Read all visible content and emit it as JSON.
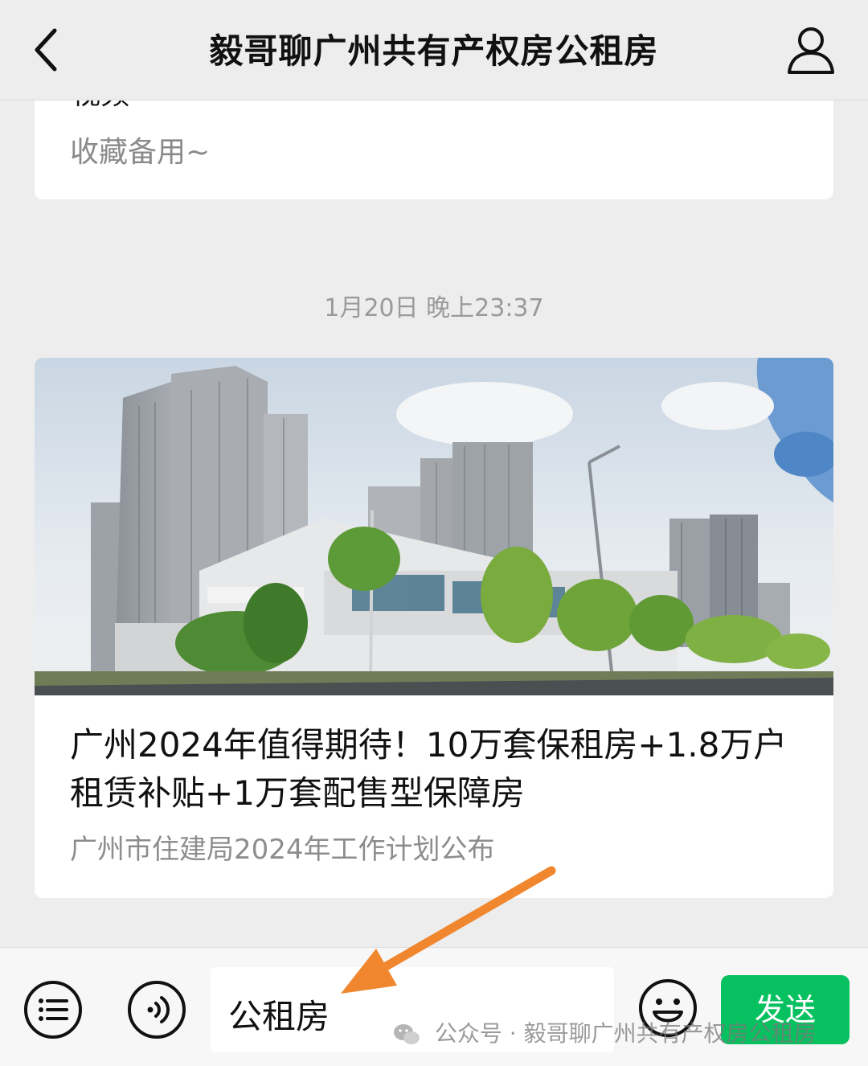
{
  "nav": {
    "title": "毅哥聊广州共有产权房公租房",
    "back_icon": "chevron-left-icon",
    "profile_icon": "person-icon"
  },
  "previous_card": {
    "partial_title": "视频",
    "description": "收藏备用~"
  },
  "timestamp": "1月20日 晚上23:37",
  "article": {
    "title": "广州2024年值得期待！10万套保租房+1.8万户租赁补贴+1万套配售型保障房",
    "subtitle": "广州市住建局2024年工作计划公布",
    "cover_alt": "high-rise residential buildings under blue sky"
  },
  "input_bar": {
    "menu_icon": "list-menu-icon",
    "voice_icon": "voice-icon",
    "input_value": "公租房",
    "emoji_icon": "emoji-icon",
    "send_label": "发送",
    "send_color": "#07c160"
  },
  "annotation": {
    "arrow_color": "#f0872e"
  },
  "watermark": {
    "text": "公众号 · 毅哥聊广州共有产权房公租房"
  }
}
